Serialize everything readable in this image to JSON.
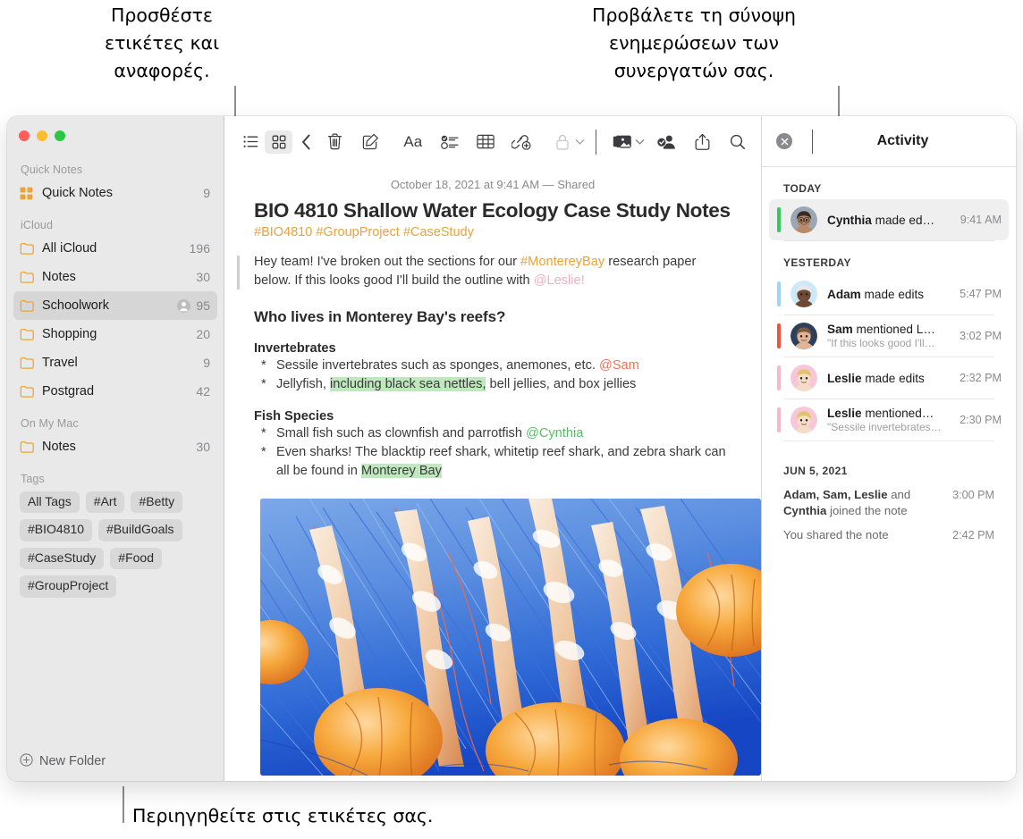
{
  "callouts": {
    "tags": "Προσθέστε\nετικέτες και\nαναφορές.",
    "activity": "Προβάλετε τη σύνοψη\nενημερώσεων των\nσυνεργατών σας.",
    "browse": "Περιηγηθείτε στις ετικέτες σας."
  },
  "sidebar": {
    "sections": [
      {
        "title": "Quick Notes",
        "rows": [
          {
            "icon": "quick-notes-icon",
            "label": "Quick Notes",
            "count": "9",
            "selected": false,
            "shared": false
          }
        ]
      },
      {
        "title": "iCloud",
        "rows": [
          {
            "icon": "folder-icon",
            "label": "All iCloud",
            "count": "196",
            "selected": false,
            "shared": false
          },
          {
            "icon": "folder-icon",
            "label": "Notes",
            "count": "30",
            "selected": false,
            "shared": false
          },
          {
            "icon": "folder-icon",
            "label": "Schoolwork",
            "count": "95",
            "selected": true,
            "shared": true
          },
          {
            "icon": "folder-icon",
            "label": "Shopping",
            "count": "20",
            "selected": false,
            "shared": false
          },
          {
            "icon": "folder-icon",
            "label": "Travel",
            "count": "9",
            "selected": false,
            "shared": false
          },
          {
            "icon": "folder-icon",
            "label": "Postgrad",
            "count": "42",
            "selected": false,
            "shared": false
          }
        ]
      },
      {
        "title": "On My Mac",
        "rows": [
          {
            "icon": "folder-icon",
            "label": "Notes",
            "count": "30",
            "selected": false,
            "shared": false
          }
        ]
      }
    ],
    "tags_title": "Tags",
    "tags": [
      "All Tags",
      "#Art",
      "#Betty",
      "#BIO4810",
      "#BuildGoals",
      "#CaseStudy",
      "#Food",
      "#GroupProject"
    ],
    "new_folder_label": "New Folder"
  },
  "toolbar": {
    "list_view": "list-view-icon",
    "gallery_view": "gallery-view-icon",
    "back": "back-chevron-icon",
    "delete": "trash-icon",
    "compose": "compose-icon",
    "format": "Aa",
    "checklist": "checklist-icon",
    "table": "table-icon",
    "link": "add-link-icon",
    "lock": "lock-icon",
    "media": "media-icon",
    "collaborate": "collaborate-icon",
    "share": "share-icon",
    "search": "search-icon"
  },
  "note": {
    "date": "October 18, 2021 at 9:41 AM — Shared",
    "title": "BIO 4810 Shallow Water Ecology Case Study Notes",
    "tags": "#BIO4810 #GroupProject #CaseStudy",
    "intro": {
      "part1": "Hey team! I've broken out the sections for our ",
      "hashtag": "#MontereyBay",
      "part2": " research paper below. If this looks good I'll build the outline with ",
      "mention": "@Leslie!"
    },
    "heading": "Who lives in Monterey Bay's reefs?",
    "sections": [
      {
        "title": "Invertebrates",
        "items": [
          {
            "pre": "Sessile invertebrates such as sponges, anemones, etc. ",
            "mention": "@Sam",
            "mention_color": "red",
            "post": "",
            "hl": "",
            "hl_post": ""
          },
          {
            "pre": "Jellyfish, ",
            "hl": "including black sea nettles,",
            "hl_post": " bell jellies, and box jellies",
            "mention": "",
            "mention_color": "",
            "post": ""
          }
        ]
      },
      {
        "title": "Fish Species",
        "items": [
          {
            "pre": "Small fish such as clownfish and parrotfish ",
            "mention": "@Cynthia",
            "mention_color": "green",
            "post": "",
            "hl": "",
            "hl_post": ""
          },
          {
            "pre": "Even sharks! The blacktip reef shark, whitetip reef shark, and zebra shark can all be found in ",
            "hl": "Monterey Bay",
            "hl_post": "",
            "mention": "",
            "mention_color": "",
            "post": ""
          }
        ]
      }
    ],
    "photo_alt": "jellyfish-photo"
  },
  "activity": {
    "title": "Activity",
    "close": "close-icon",
    "groups": [
      {
        "title": "TODAY",
        "items": [
          {
            "avatar": "cynthia",
            "bar": "#34c759",
            "name": "Cynthia",
            "action": " made ed…",
            "quote": "",
            "time": "9:41 AM",
            "highlight": true
          }
        ]
      },
      {
        "title": "YESTERDAY",
        "items": [
          {
            "avatar": "adam",
            "bar": "#9fd4f5",
            "name": "Adam",
            "action": " made edits",
            "quote": "",
            "time": "5:47 PM",
            "highlight": false
          },
          {
            "avatar": "sam",
            "bar": "#f1503c",
            "name": "Sam",
            "action": " mentioned L…",
            "quote": "\"If this looks good I'll…",
            "time": "3:02 PM",
            "highlight": false
          },
          {
            "avatar": "leslie",
            "bar": "#f7b8cd",
            "name": "Leslie",
            "action": " made edits",
            "quote": "",
            "time": "2:32 PM",
            "highlight": false
          },
          {
            "avatar": "leslie",
            "bar": "#f7b8cd",
            "name": "Leslie",
            "action": " mentioned…",
            "quote": "\"Sessile invertebrates…",
            "time": "2:30 PM",
            "highlight": false
          }
        ]
      }
    ],
    "older": {
      "title": "JUN 5, 2021",
      "entries": [
        {
          "bold": "Adam, Sam, Leslie",
          "mid": " and ",
          "bold2": "Cynthia",
          "rest": " joined the note",
          "time": "3:00 PM"
        },
        {
          "bold": "",
          "mid": "",
          "bold2": "",
          "rest": "You shared the note",
          "time": "2:42 PM"
        }
      ]
    }
  },
  "colors": {
    "accent_tag": "#e8a33d",
    "highlight_green": "#bfe8bd",
    "mention_pink": "#f5adc0",
    "mention_red": "#f1705e",
    "mention_green": "#58bd60",
    "folder_icon": "#f0a32e",
    "sidebar_bg": "#e9e9e9"
  }
}
